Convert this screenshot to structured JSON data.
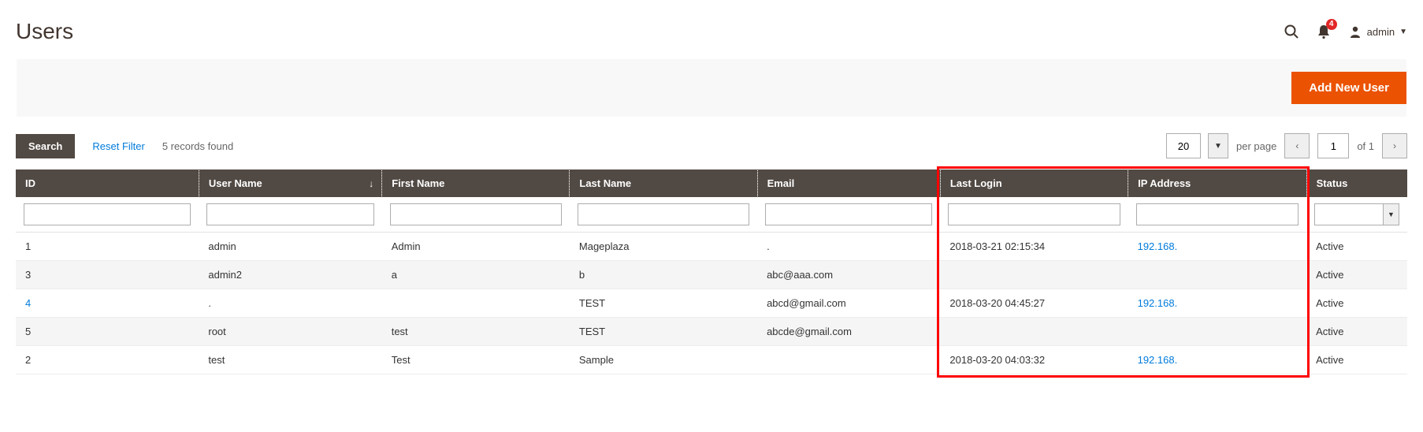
{
  "page_title": "Users",
  "notification_count": "4",
  "current_user": "admin",
  "add_button": "Add New User",
  "toolbar": {
    "search": "Search",
    "reset_filter": "Reset Filter",
    "records_found": "5 records found",
    "page_size": "20",
    "per_page": "per page",
    "current_page": "1",
    "of": "of 1"
  },
  "columns": {
    "id": "ID",
    "username": "User Name",
    "firstname": "First Name",
    "lastname": "Last Name",
    "email": "Email",
    "lastlogin": "Last Login",
    "ip": "IP Address",
    "status": "Status"
  },
  "rows": [
    {
      "id": "1",
      "username": "admin",
      "firstname": "Admin",
      "lastname": "Mageplaza",
      "email": ".",
      "lastlogin": "2018-03-21 02:15:34",
      "ip": "192.168.",
      "status": "Active",
      "id_link": false,
      "ip_link": true
    },
    {
      "id": "3",
      "username": "admin2",
      "firstname": "a",
      "lastname": "b",
      "email": "abc@aaa.com",
      "lastlogin": "",
      "ip": "",
      "status": "Active",
      "id_link": false,
      "ip_link": false
    },
    {
      "id": "4",
      "username": ".",
      "firstname": "",
      "lastname": "TEST",
      "email": "abcd@gmail.com",
      "lastlogin": "2018-03-20 04:45:27",
      "ip": "192.168.",
      "status": "Active",
      "id_link": true,
      "ip_link": true
    },
    {
      "id": "5",
      "username": "root",
      "firstname": "test",
      "lastname": "TEST",
      "email": "abcde@gmail.com",
      "lastlogin": "",
      "ip": "",
      "status": "Active",
      "id_link": false,
      "ip_link": false
    },
    {
      "id": "2",
      "username": "test",
      "firstname": "Test",
      "lastname": "Sample",
      "email": "",
      "lastlogin": "2018-03-20 04:03:32",
      "ip": "192.168.",
      "status": "Active",
      "id_link": false,
      "ip_link": true
    }
  ]
}
